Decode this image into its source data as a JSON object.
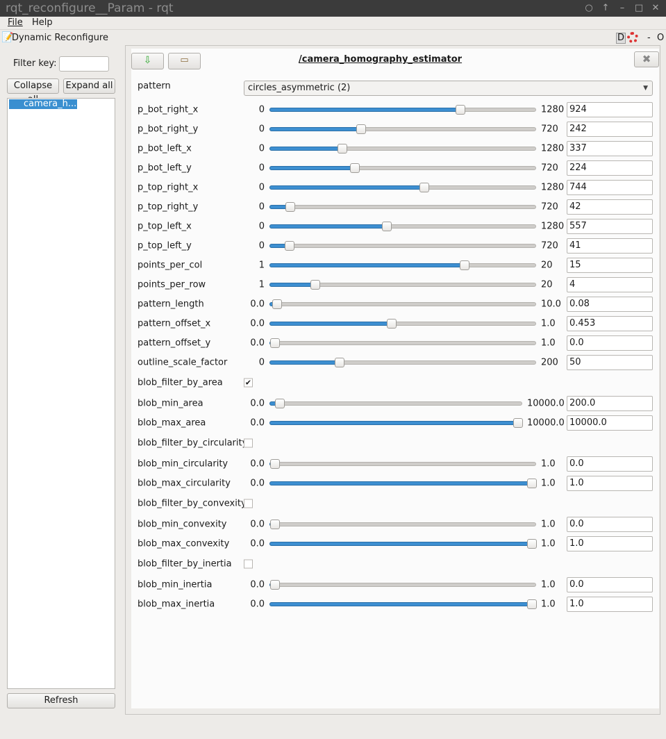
{
  "window": {
    "title": "rqt_reconfigure__Param - rqt"
  },
  "menu": {
    "file": "File",
    "help": "Help"
  },
  "dock": {
    "title": "Dynamic Reconfigure",
    "d_label": "D",
    "minus": "-",
    "o_label": "O"
  },
  "sidebar": {
    "filter_label": "Filter key:",
    "filter_value": "",
    "collapse_all": "Collapse all",
    "expand_all": "Expand all",
    "tree_items": [
      "camera_h..."
    ],
    "refresh": "Refresh"
  },
  "node": {
    "title": "/camera_homography_estimator"
  },
  "pattern": {
    "label": "pattern",
    "selected": "circles_asymmetric (2)"
  },
  "colors": {
    "accent": "#3d8fd1",
    "titlebar": "#3b3b3b"
  },
  "params": [
    {
      "type": "slider",
      "name": "p_bot_right_x",
      "min": "0",
      "max": "1280",
      "value": "924"
    },
    {
      "type": "slider",
      "name": "p_bot_right_y",
      "min": "0",
      "max": "720",
      "value": "242"
    },
    {
      "type": "slider",
      "name": "p_bot_left_x",
      "min": "0",
      "max": "1280",
      "value": "337"
    },
    {
      "type": "slider",
      "name": "p_bot_left_y",
      "min": "0",
      "max": "720",
      "value": "224"
    },
    {
      "type": "slider",
      "name": "p_top_right_x",
      "min": "0",
      "max": "1280",
      "value": "744"
    },
    {
      "type": "slider",
      "name": "p_top_right_y",
      "min": "0",
      "max": "720",
      "value": "42"
    },
    {
      "type": "slider",
      "name": "p_top_left_x",
      "min": "0",
      "max": "1280",
      "value": "557"
    },
    {
      "type": "slider",
      "name": "p_top_left_y",
      "min": "0",
      "max": "720",
      "value": "41"
    },
    {
      "type": "slider",
      "name": "points_per_col",
      "min": "1",
      "max": "20",
      "value": "15"
    },
    {
      "type": "slider",
      "name": "points_per_row",
      "min": "1",
      "max": "20",
      "value": "4"
    },
    {
      "type": "slider",
      "name": "pattern_length",
      "min": "0.0",
      "max": "10.0",
      "value": "0.08"
    },
    {
      "type": "slider",
      "name": "pattern_offset_x",
      "min": "0.0",
      "max": "1.0",
      "value": "0.453"
    },
    {
      "type": "slider",
      "name": "pattern_offset_y",
      "min": "0.0",
      "max": "1.0",
      "value": "0.0"
    },
    {
      "type": "slider",
      "name": "outline_scale_factor",
      "min": "0",
      "max": "200",
      "value": "50"
    },
    {
      "type": "check",
      "name": "blob_filter_by_area",
      "checked": true
    },
    {
      "type": "slider",
      "name": "blob_min_area",
      "min": "0.0",
      "max": "10000.0",
      "value": "200.0"
    },
    {
      "type": "slider",
      "name": "blob_max_area",
      "min": "0.0",
      "max": "10000.0",
      "value": "10000.0"
    },
    {
      "type": "check",
      "name": "blob_filter_by_circularity",
      "checked": false
    },
    {
      "type": "slider",
      "name": "blob_min_circularity",
      "min": "0.0",
      "max": "1.0",
      "value": "0.0"
    },
    {
      "type": "slider",
      "name": "blob_max_circularity",
      "min": "0.0",
      "max": "1.0",
      "value": "1.0"
    },
    {
      "type": "check",
      "name": "blob_filter_by_convexity",
      "checked": false
    },
    {
      "type": "slider",
      "name": "blob_min_convexity",
      "min": "0.0",
      "max": "1.0",
      "value": "0.0"
    },
    {
      "type": "slider",
      "name": "blob_max_convexity",
      "min": "0.0",
      "max": "1.0",
      "value": "1.0"
    },
    {
      "type": "check",
      "name": "blob_filter_by_inertia",
      "checked": false
    },
    {
      "type": "slider",
      "name": "blob_min_inertia",
      "min": "0.0",
      "max": "1.0",
      "value": "0.0"
    },
    {
      "type": "slider",
      "name": "blob_max_inertia",
      "min": "0.0",
      "max": "1.0",
      "value": "1.0"
    }
  ]
}
